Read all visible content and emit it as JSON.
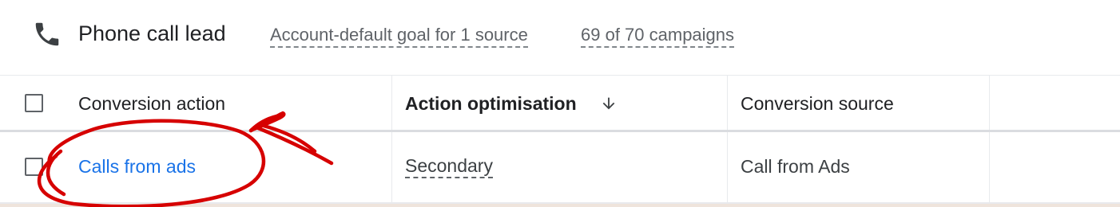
{
  "goal": {
    "icon": "phone-icon",
    "title": "Phone call lead",
    "sources_link": "Account-default goal for 1 source",
    "campaigns_link": "69 of 70 campaigns"
  },
  "table": {
    "columns": [
      "Conversion action",
      "Action optimisation",
      "Conversion source"
    ],
    "sort_icon": "arrow-down-icon",
    "rows": [
      {
        "conversion_action": "Calls from ads",
        "action_optimisation": "Secondary",
        "conversion_source": "Call from Ads"
      }
    ]
  },
  "colors": {
    "link_blue": "#1a73e8",
    "annotation_red": "#d60000"
  }
}
